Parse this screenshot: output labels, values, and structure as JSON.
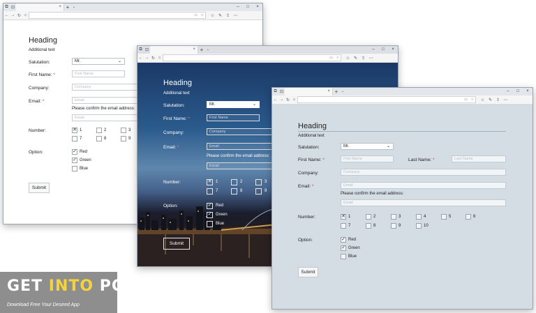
{
  "browser": {
    "tab_close": "×",
    "new_tab": "+",
    "tab_menu": "⌄",
    "window_controls": [
      "–",
      "□",
      "×"
    ],
    "nav": [
      "←",
      "→",
      "↻",
      "⌂"
    ],
    "addr_icons": [
      "▭",
      "☆"
    ],
    "toolbar_icons": [
      "☆",
      "✎",
      "⇪",
      "⋯"
    ]
  },
  "form": {
    "heading": "Heading",
    "subtext": "Additional text",
    "salutation_label": "Salutation:",
    "salutation_value": "Mr.",
    "firstname_label": "First Name:",
    "firstname_placeholder": "First Name",
    "lastname_label": "Last Name:",
    "lastname_placeholder": "Last Name",
    "company_label": "Company:",
    "company_placeholder": "Company",
    "email_label": "Email:",
    "email_placeholder": "Email",
    "confirm_text": "Please confirm the email address:",
    "number_label": "Number:",
    "numbers": [
      "1",
      "2",
      "3",
      "4",
      "5",
      "6",
      "7",
      "8",
      "9",
      "10"
    ],
    "option_label": "Option:",
    "options": [
      "Red",
      "Green",
      "Blue"
    ],
    "submit_label": "Submit",
    "required_mark": "*"
  },
  "states": {
    "number_checked": "1",
    "options_checked": [
      "Red",
      "Green"
    ]
  },
  "logo": {
    "part1": "GET ",
    "part2": "INTO",
    "part3": " PC",
    "tagline": "Download Free Your Desired App"
  },
  "colors": {
    "required": "#d33333",
    "logo_highlight": "#f5d33a",
    "logo_bg": "#8e8e8e"
  }
}
